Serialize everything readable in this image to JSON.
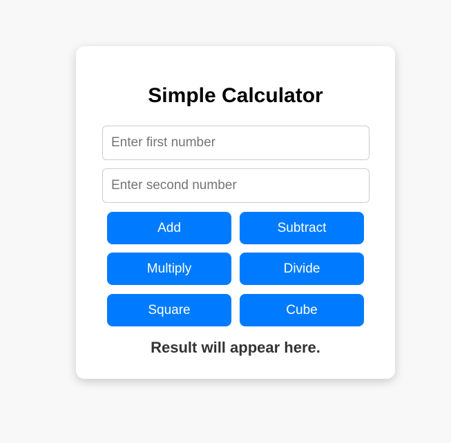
{
  "calculator": {
    "title": "Simple Calculator",
    "first_input": {
      "value": "",
      "placeholder": "Enter first number"
    },
    "second_input": {
      "value": "",
      "placeholder": "Enter second number"
    },
    "buttons": {
      "add": "Add",
      "subtract": "Subtract",
      "multiply": "Multiply",
      "divide": "Divide",
      "square": "Square",
      "cube": "Cube"
    },
    "result_text": "Result will appear here."
  },
  "colors": {
    "page_background": "#f8f8f8",
    "card_background": "#ffffff",
    "button_background": "#007bff",
    "button_text": "#ffffff",
    "title_text": "#000000",
    "result_text": "#333333"
  }
}
